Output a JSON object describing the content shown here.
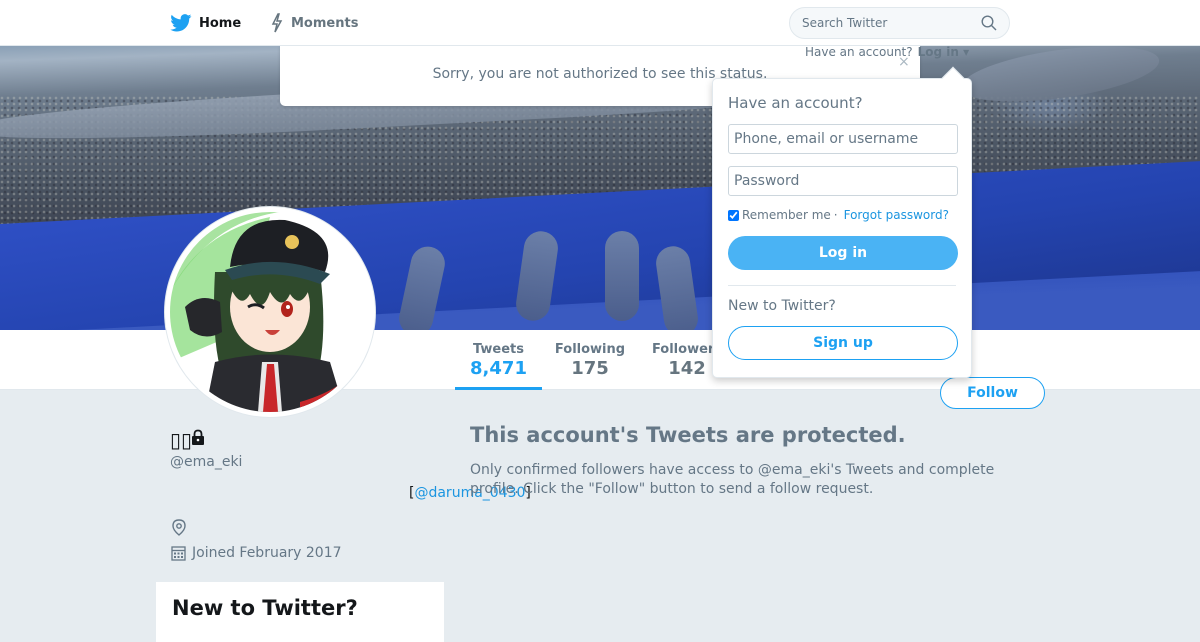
{
  "nav": {
    "home_label": "Home",
    "moments_label": "Moments",
    "search_placeholder": "Search Twitter"
  },
  "alert": {
    "message": "Sorry, you are not authorized to see this status.",
    "close": "×"
  },
  "account_bar": {
    "prompt": "Have an account?",
    "login_link": "Log in"
  },
  "login_dropdown": {
    "title": "Have an account?",
    "username_placeholder": "Phone, email or username",
    "password_placeholder": "Password",
    "remember_label": "Remember me",
    "separator": "·",
    "forgot_label": "Forgot password?",
    "login_button": "Log in",
    "new_prompt": "New to Twitter?",
    "signup_button": "Sign up"
  },
  "profile": {
    "handle": "@ema_eki",
    "joined": "Joined February 2017",
    "mention_open": "[",
    "mention": "@daruma_0430",
    "mention_close": "]"
  },
  "stats": [
    {
      "label": "Tweets",
      "value": "8,471",
      "active": true
    },
    {
      "label": "Following",
      "value": "175",
      "active": false
    },
    {
      "label": "Followers",
      "value": "142",
      "active": false
    }
  ],
  "follow_button": "Follow",
  "protected": {
    "title": "This account's Tweets are protected.",
    "text": "Only confirmed followers have access to @ema_eki's Tweets and complete profile. Click the \"Follow\" button to send a follow request."
  },
  "sidebar_card": {
    "title": "New to Twitter?"
  },
  "colors": {
    "accent": "#1da1f2",
    "link": "#1b95e0",
    "background": "#e6ecf0",
    "muted": "#657786"
  }
}
